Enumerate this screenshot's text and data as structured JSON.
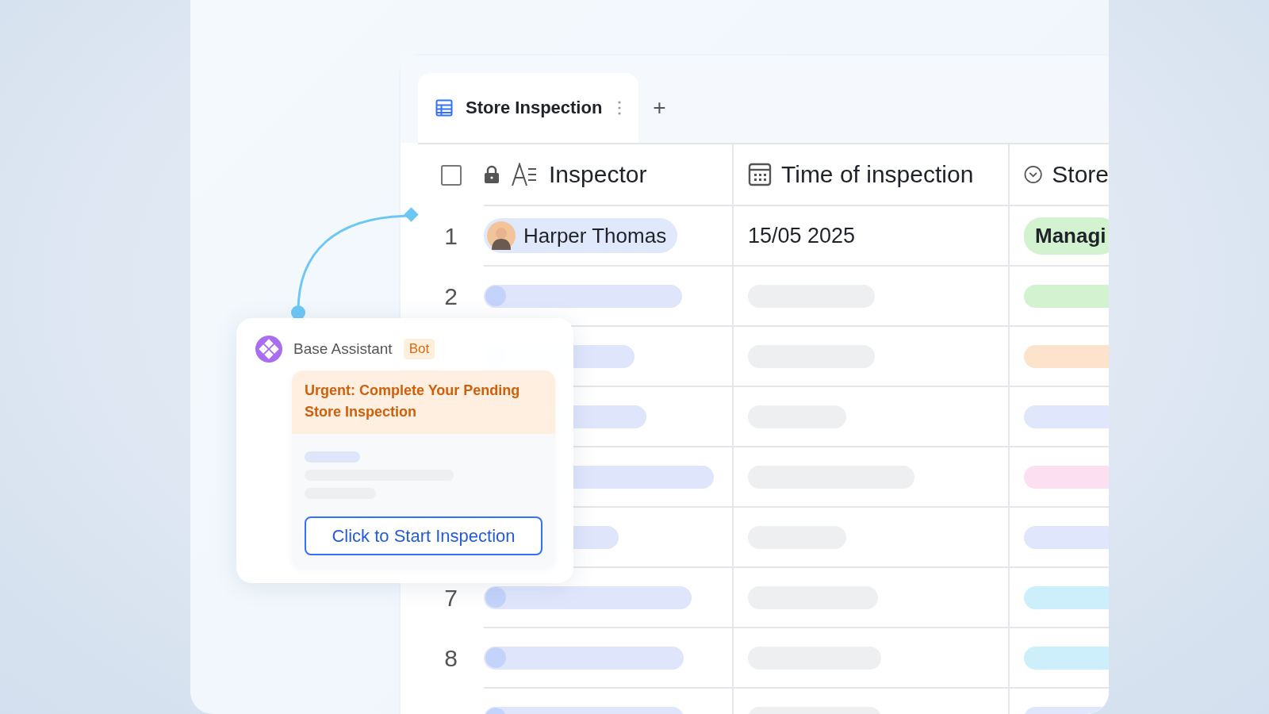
{
  "tabs": [
    {
      "label": "Store Inspection",
      "selected": true
    }
  ],
  "add_tab": "+",
  "select_all": {
    "checked": false
  },
  "columns": [
    {
      "kind": "text",
      "label": "Inspector"
    },
    {
      "kind": "date",
      "label": "Time of inspection"
    },
    {
      "kind": "select",
      "label": "Store"
    }
  ],
  "rows": [
    {
      "number": "1",
      "inspector": "Harper Thomas",
      "time": "15/05 2025",
      "store": "Managi",
      "color": "#d3f2cf"
    },
    {
      "number": "2",
      "color": "#d3f2cf"
    },
    {
      "color": "#fde3cc"
    },
    {
      "color": "#e0e7fc"
    },
    {
      "color": "#fcdff0"
    },
    {
      "color": "#e0e7fc"
    },
    {
      "number": "7",
      "color": "#cdeefb"
    },
    {
      "number": "8",
      "color": "#cdeefb"
    },
    {
      "color": "#e0e7fc"
    }
  ],
  "assistant": {
    "name": "Base Assistant",
    "badge": "Bot",
    "title": "Urgent: Complete Your Pending Store Inspection",
    "button": "Click to Start Inspection"
  }
}
